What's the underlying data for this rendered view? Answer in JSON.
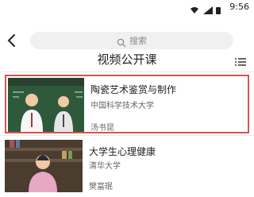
{
  "status": {
    "time": "9:56"
  },
  "header": {
    "search_placeholder": "搜索",
    "title": "视频公开课"
  },
  "courses": [
    {
      "title": "陶瓷艺术鉴赏与制作",
      "school": "中国科学技术大学",
      "teacher": "汤书昆",
      "selected": true
    },
    {
      "title": "大学生心理健康",
      "school": "清华大学",
      "teacher": "樊富珉",
      "selected": false
    }
  ],
  "colors": {
    "accent_border": "#d9534f",
    "search_bg": "#f0f0f0"
  }
}
